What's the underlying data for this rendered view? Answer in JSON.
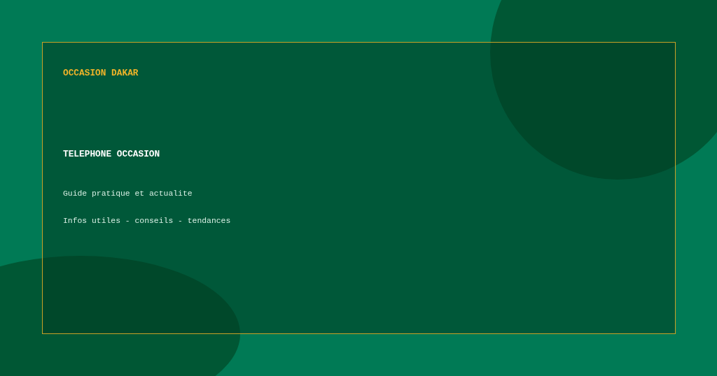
{
  "brand": "OCCASION DAKAR",
  "title": "TELEPHONE OCCASION",
  "lines": [
    "Guide pratique et actualite",
    "Infos utiles - conseils - tendances"
  ]
}
